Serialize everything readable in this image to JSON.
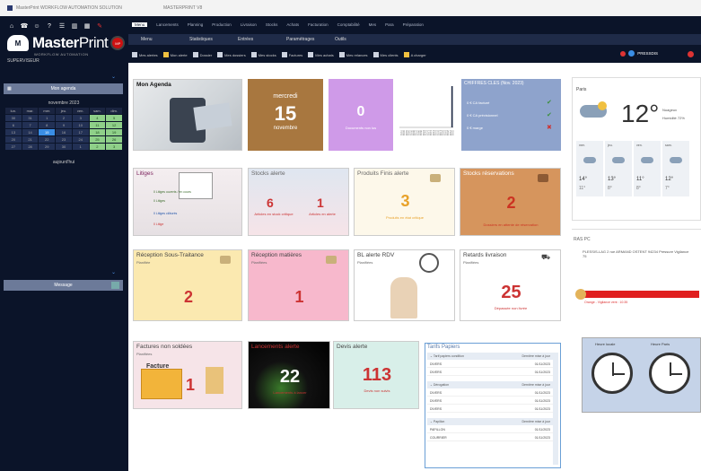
{
  "window": {
    "title_left": "MasterPrint WORKFLOW AUTOMATION SOLUTION",
    "title_mid": "MASTERPRINT V8"
  },
  "logo": {
    "part1": "Master",
    "part2": "Print",
    "subtitle": "WORKFLOW AUTOMATION",
    "badge": "MP"
  },
  "user": {
    "name": "SUPERVISEUR"
  },
  "quickbar": [
    "home-icon",
    "phone-icon",
    "user-icon",
    "help-icon",
    "list-icon",
    "chart-icon",
    "grid-icon",
    "edit-icon"
  ],
  "sidebar": {
    "agenda_header": "Mon agenda",
    "calendar_month": "novembre 2023",
    "calendar_headers": [
      "lun.",
      "mar.",
      "mer.",
      "jeu.",
      "ven.",
      "sam.",
      "dim."
    ],
    "calendar_days": [
      "30",
      "31",
      "1",
      "2",
      "3",
      "4",
      "5",
      "6",
      "7",
      "8",
      "9",
      "10",
      "11",
      "12",
      "13",
      "14",
      "15",
      "16",
      "17",
      "18",
      "19",
      "20",
      "21",
      "22",
      "23",
      "24",
      "25",
      "26",
      "27",
      "28",
      "29",
      "30",
      "1",
      "2",
      "3"
    ],
    "today_label": "aujourd'hui",
    "message_header": "Message"
  },
  "nav": {
    "tabs": [
      "Menu",
      "Lancements",
      "Planning",
      "Production",
      "Livraison",
      "Stocks",
      "Achats",
      "Facturation",
      "Comptabilité",
      "Mes",
      "Para",
      "Préparation"
    ]
  },
  "menu": [
    "Menu",
    "Statistiques",
    "Entrées",
    "Paramétrages",
    "Outils"
  ],
  "actions": [
    "Mes alertes",
    "Mon alerte",
    "Dossier",
    "Mes dossiers",
    "Mes stocks",
    "Factures",
    "Mes achats",
    "Mes relances",
    "Mes clients",
    "A charger"
  ],
  "presdis": {
    "label": "PRESSDIS"
  },
  "tiles": {
    "agenda": {
      "title": "Mon Agenda"
    },
    "date": {
      "day_name": "mercredi",
      "day": "15",
      "month": "novembre"
    },
    "purple": {
      "value": "0",
      "caption": "Documents non lus"
    },
    "bars": {
      "values": [
        0,
        0,
        0,
        0,
        0,
        0,
        0,
        0,
        0,
        0,
        0,
        0,
        0,
        0,
        0,
        0,
        0,
        0,
        0,
        0,
        0,
        1
      ],
      "labels": [
        "01/11",
        "02/11",
        "03/11",
        "04/11",
        "05/11",
        "06/11",
        "07/11",
        "08/11",
        "09/11",
        "10/11",
        "11/11",
        "12/11",
        "13/11",
        "14/11",
        "15/11",
        "16/11",
        "17/11",
        "18/11",
        "19/11",
        "20/11",
        "21/11",
        "22/11"
      ]
    },
    "chiffres": {
      "title": "CHIFFRES CLES (Nov. 2023)",
      "items": [
        "0 € CA facturé",
        "0 € CA prévisionnel",
        "0 € marge"
      ]
    },
    "litiges": {
      "title": "Litiges",
      "lines": [
        "0 Litiges ouverts / en cours",
        "0 Litiges",
        "0 Litiges clôturés",
        "0 Litige"
      ]
    },
    "stocks": {
      "title": "Stocks alerte",
      "v1": "6",
      "c1": "Articles en stock critique",
      "v2": "1",
      "c2": "Articles en alerte"
    },
    "pf": {
      "title": "Produits Finis alerte",
      "value": "3",
      "caption": "Produits en état critique"
    },
    "resa": {
      "title": "Stocks réservations",
      "value": "2",
      "caption": "Dossiers en attente de réservation"
    },
    "stt": {
      "title": "Réception Sous-Traitance",
      "sub": "Planifiée",
      "value": "2"
    },
    "rm": {
      "title": "Réception matières",
      "sub": "Planifiées",
      "value": "1"
    },
    "bl": {
      "title": "BL alerte RDV",
      "sub": "Planifiées"
    },
    "retards": {
      "title": "Retards livraison",
      "sub": "Planifiées",
      "value": "25",
      "caption": "Dépassée non livrée"
    },
    "factures": {
      "title": "Factures non soldées",
      "sub": "Planifiées",
      "label": "Facture",
      "value": "1"
    },
    "lancements": {
      "title": "Lancements alerte",
      "value": "22",
      "caption": "Lancements à lancer"
    },
    "devis": {
      "title": "Devis alerte",
      "value": "113",
      "caption": "Devis non suivis"
    }
  },
  "weather": {
    "city": "Paris",
    "temp": "12°",
    "condition": "Nuageux",
    "humidity": "Humidité 72%",
    "forecast": [
      {
        "day": "mer.",
        "high": "14°",
        "low": "11°"
      },
      {
        "day": "jeu.",
        "high": "13°",
        "low": "8°"
      },
      {
        "day": "ven.",
        "high": "11°",
        "low": "8°"
      },
      {
        "day": "sam.",
        "high": "12°",
        "low": "7°"
      }
    ]
  },
  "weather_alert": {
    "title": "RAS PC",
    "address": "PLESSIS-LAG 2 rue ARMAND OSTENT 94234 Pressure Vigilance 75",
    "note": "Orange - Vigilance vent : 10:35"
  },
  "clocks": {
    "left_label": "Heure locale",
    "right_label": "Heure Paris"
  },
  "tableau": {
    "title": "Tarifs Papiers",
    "groups": [
      {
        "name": "Tarif papiers condition",
        "col": "Dernière mise à jour",
        "rows": [
          {
            "name": "DIVERS",
            "date": "01/11/2023"
          },
          {
            "name": "DIVERS",
            "date": "01/11/2023"
          }
        ]
      },
      {
        "name": "Dérogation",
        "col": "Dernière mise à jour",
        "rows": [
          {
            "name": "DIVERS",
            "date": "01/11/2023"
          },
          {
            "name": "DIVERS",
            "date": "01/11/2023"
          },
          {
            "name": "DIVERS",
            "date": "01/11/2023"
          }
        ]
      },
      {
        "name": "Papillon",
        "col": "Dernière mise à jour",
        "rows": [
          {
            "name": "PAPILLON",
            "date": "01/11/2023"
          },
          {
            "name": "COURRIER",
            "date": "01/11/2023"
          }
        ]
      }
    ]
  }
}
